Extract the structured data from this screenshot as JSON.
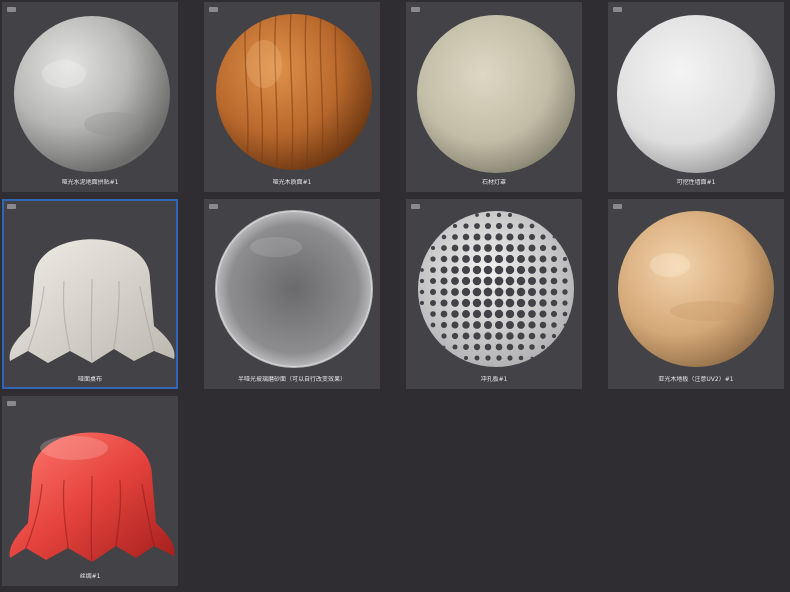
{
  "materials": [
    {
      "label": "哑光水泥地面拼贴#1",
      "icon": "concrete-sphere-icon",
      "selected": false
    },
    {
      "label": "哑光木质面#1",
      "icon": "wood-sphere-icon",
      "selected": false
    },
    {
      "label": "石材灯罩",
      "icon": "stone-sphere-icon",
      "selected": false
    },
    {
      "label": "可挖性墙面#1",
      "icon": "white-sphere-icon",
      "selected": false
    },
    {
      "label": "哑面桌布",
      "icon": "white-cloth-icon",
      "selected": true
    },
    {
      "label": "半哑光玻璃磨砂面（可以自行改变效果）",
      "icon": "glass-sphere-icon",
      "selected": false
    },
    {
      "label": "冲孔板#1",
      "icon": "perforated-sphere-icon",
      "selected": false
    },
    {
      "label": "亚光木地板（注意UV2）#1",
      "icon": "light-wood-sphere-icon",
      "selected": false
    },
    {
      "label": "丝绸#1",
      "icon": "red-silk-cloth-icon",
      "selected": false
    }
  ],
  "colors": {
    "background": "#2f2d32",
    "card": "#434246",
    "selection": "#2f67b6",
    "label": "#e6e6e6"
  }
}
